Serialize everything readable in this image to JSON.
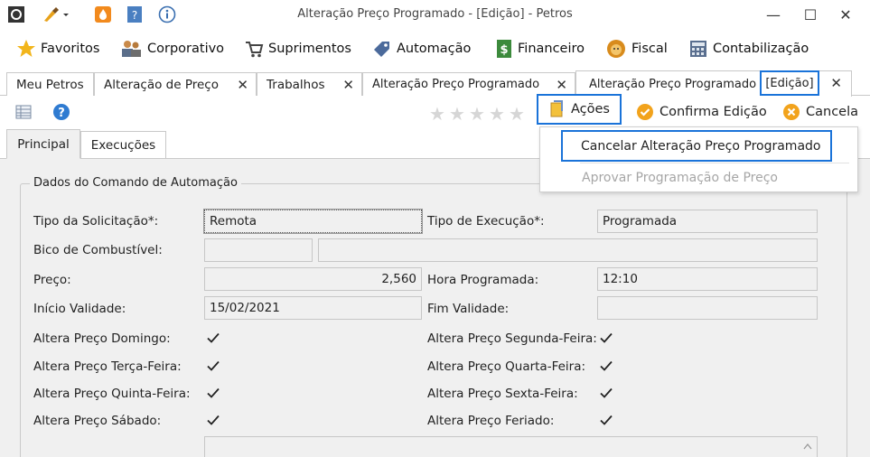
{
  "window": {
    "title": "Alteração Preço Programado - [Edição] - Petros",
    "minimize": "—",
    "maximize": "☐",
    "close": "✕"
  },
  "menu": [
    {
      "label": "Favoritos",
      "icon": "star-icon"
    },
    {
      "label": "Corporativo",
      "icon": "people-icon"
    },
    {
      "label": "Suprimentos",
      "icon": "cart-icon"
    },
    {
      "label": "Automação",
      "icon": "tag-icon"
    },
    {
      "label": "Financeiro",
      "icon": "money-icon"
    },
    {
      "label": "Fiscal",
      "icon": "lion-icon"
    },
    {
      "label": "Contabilização",
      "icon": "calculator-icon"
    }
  ],
  "tabs": [
    {
      "label": "Meu Petros",
      "closable": false
    },
    {
      "label": "Alteração de Preço",
      "closable": true
    },
    {
      "label": "Trabalhos",
      "closable": true
    },
    {
      "label": "Alteração Preço Programado",
      "closable": true
    },
    {
      "label": "Alteração Preço Programado",
      "suffix": "[Edição]",
      "closable": true,
      "active": true
    }
  ],
  "toolbar": {
    "actions_label": "Ações",
    "confirm_label": "Confirma Edição",
    "cancel_label": "Cancela",
    "rating_stars": 5
  },
  "actions_menu": {
    "items": [
      {
        "label": "Cancelar Alteração Preço Programado",
        "enabled": true
      },
      {
        "label": "Aprovar Programação de Preço",
        "enabled": false
      }
    ]
  },
  "subtabs": [
    {
      "label": "Principal",
      "active": true
    },
    {
      "label": "Execuções",
      "active": false
    }
  ],
  "form": {
    "legend": "Dados do Comando de Automação",
    "tipo_solicitacao_label": "Tipo da Solicitação*:",
    "tipo_solicitacao_value": "Remota",
    "tipo_execucao_label": "Tipo de Execução*:",
    "tipo_execucao_value": "Programada",
    "bico_label": "Bico de Combustível:",
    "bico_value": "",
    "bico_desc": "",
    "preco_label": "Preço:",
    "preco_value": "2,560",
    "hora_label": "Hora Programada:",
    "hora_value": "12:10",
    "inicio_label": "Início Validade:",
    "inicio_value": "15/02/2021",
    "fim_label": "Fim Validade:",
    "fim_value": "",
    "checks_left": [
      {
        "label": "Altera Preço Domingo:",
        "checked": true
      },
      {
        "label": "Altera Preço Terça-Feira:",
        "checked": true
      },
      {
        "label": "Altera Preço Quinta-Feira:",
        "checked": true
      },
      {
        "label": "Altera Preço Sábado:",
        "checked": true
      }
    ],
    "checks_right": [
      {
        "label": "Altera Preço Segunda-Feira:",
        "checked": true
      },
      {
        "label": "Altera Preço Quarta-Feira:",
        "checked": true
      },
      {
        "label": "Altera Preço Sexta-Feira:",
        "checked": true
      },
      {
        "label": "Altera Preço Feriado:",
        "checked": true
      }
    ]
  },
  "colors": {
    "highlight": "#1a73d9",
    "content_bg": "#f0f0f0",
    "star_gray": "#d6d6d6"
  }
}
